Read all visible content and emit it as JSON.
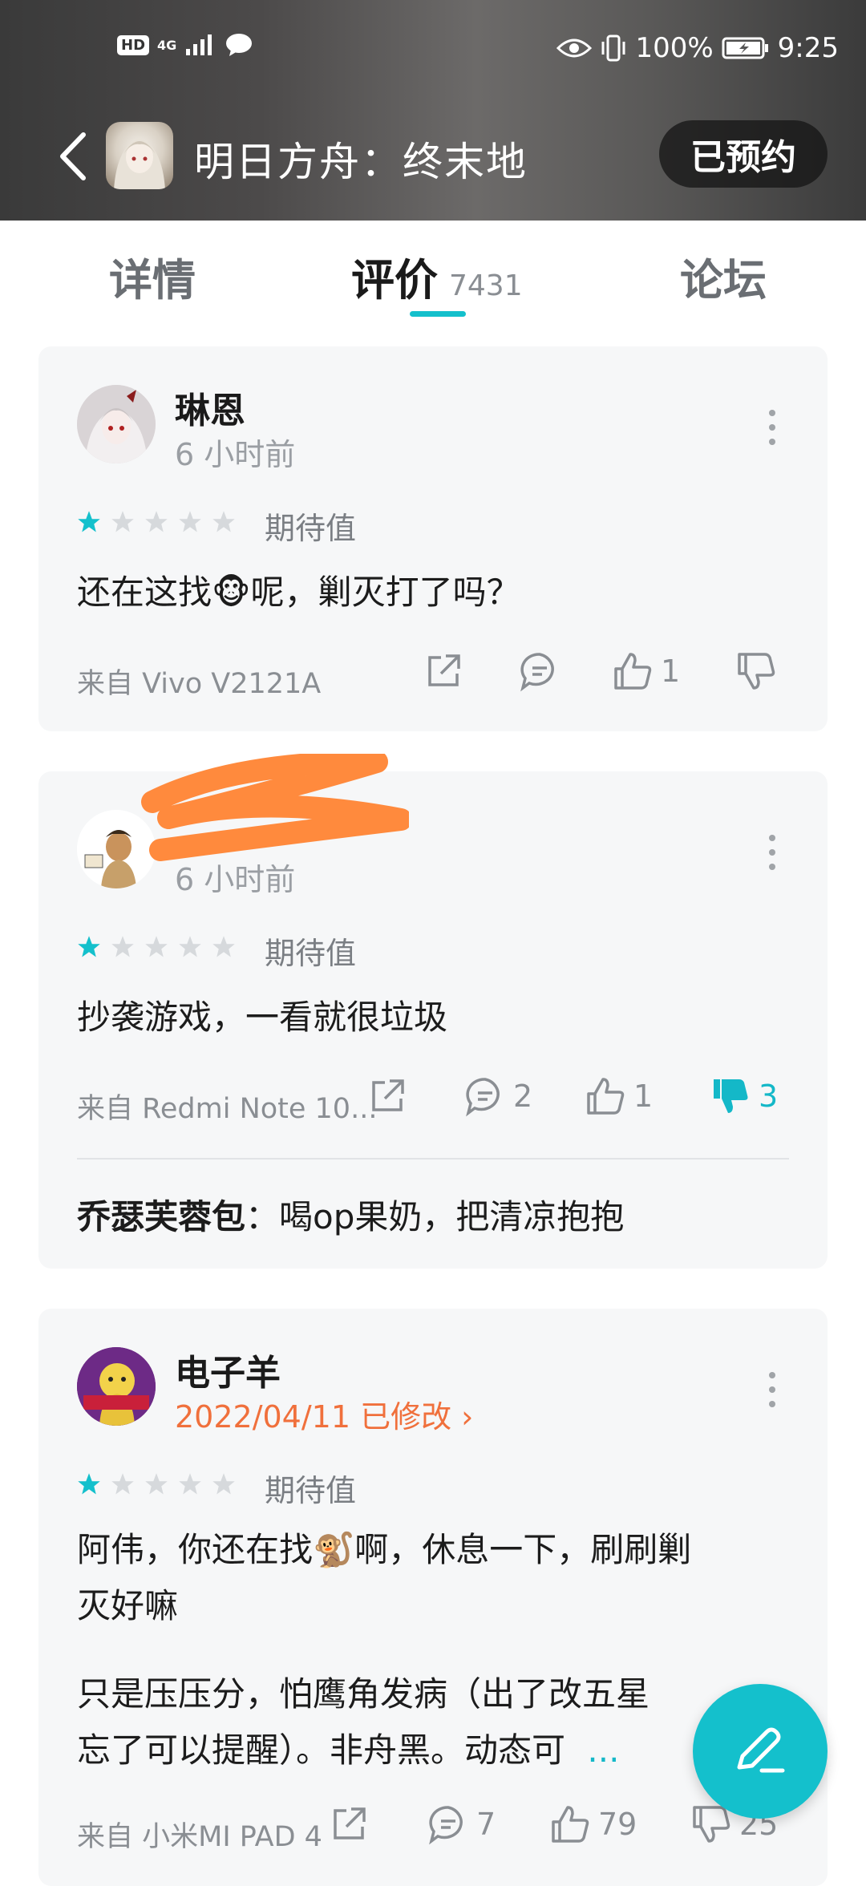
{
  "status_bar": {
    "hd": "HD",
    "network": "4G",
    "battery": "100%",
    "time": "9:25"
  },
  "header": {
    "title": "明日方舟：终末地",
    "reserve_button": "已预约"
  },
  "tabs": [
    {
      "label": "详情"
    },
    {
      "label": "评价",
      "count": "7431"
    },
    {
      "label": "论坛"
    }
  ],
  "reviews": [
    {
      "username": "琳恩",
      "time": "6 小时前",
      "rating": 1,
      "rating_label": "期待值",
      "text": "还在这找🐵呢，剿灭打了吗？",
      "device": "来自 Vivo V2121A",
      "comments": "",
      "likes": "1",
      "dislikes": ""
    },
    {
      "username": "",
      "time": "6 小时前",
      "rating": 1,
      "rating_label": "期待值",
      "text": "抄袭游戏，一看就很垃圾",
      "device": "来自 Redmi Note 10...",
      "comments": "2",
      "likes": "1",
      "dislikes": "3",
      "reply_author": "乔瑟芙蓉包",
      "reply_text": "：喝op果奶，把清凉抱抱"
    },
    {
      "username": "电子羊",
      "time": "2022/04/11 已修改 ›",
      "rating": 1,
      "rating_label": "期待值",
      "text_line1": "阿伟，你还在找🐒啊，休息一下，刷刷剿",
      "text_line2": "灭好嘛",
      "text2_line1": "只是压压分，怕鹰角发病（出了改五星",
      "text2_line2": "忘了可以提醒）。非舟黑。动态可",
      "more_label": "...",
      "device": "来自 小米MI PAD 4",
      "comments": "7",
      "likes": "79",
      "dislikes": "25"
    }
  ],
  "colors": {
    "accent": "#14c0cc",
    "modified": "#f0703c",
    "card_bg": "#f6f7f8",
    "redaction": "#ff8a3d"
  }
}
